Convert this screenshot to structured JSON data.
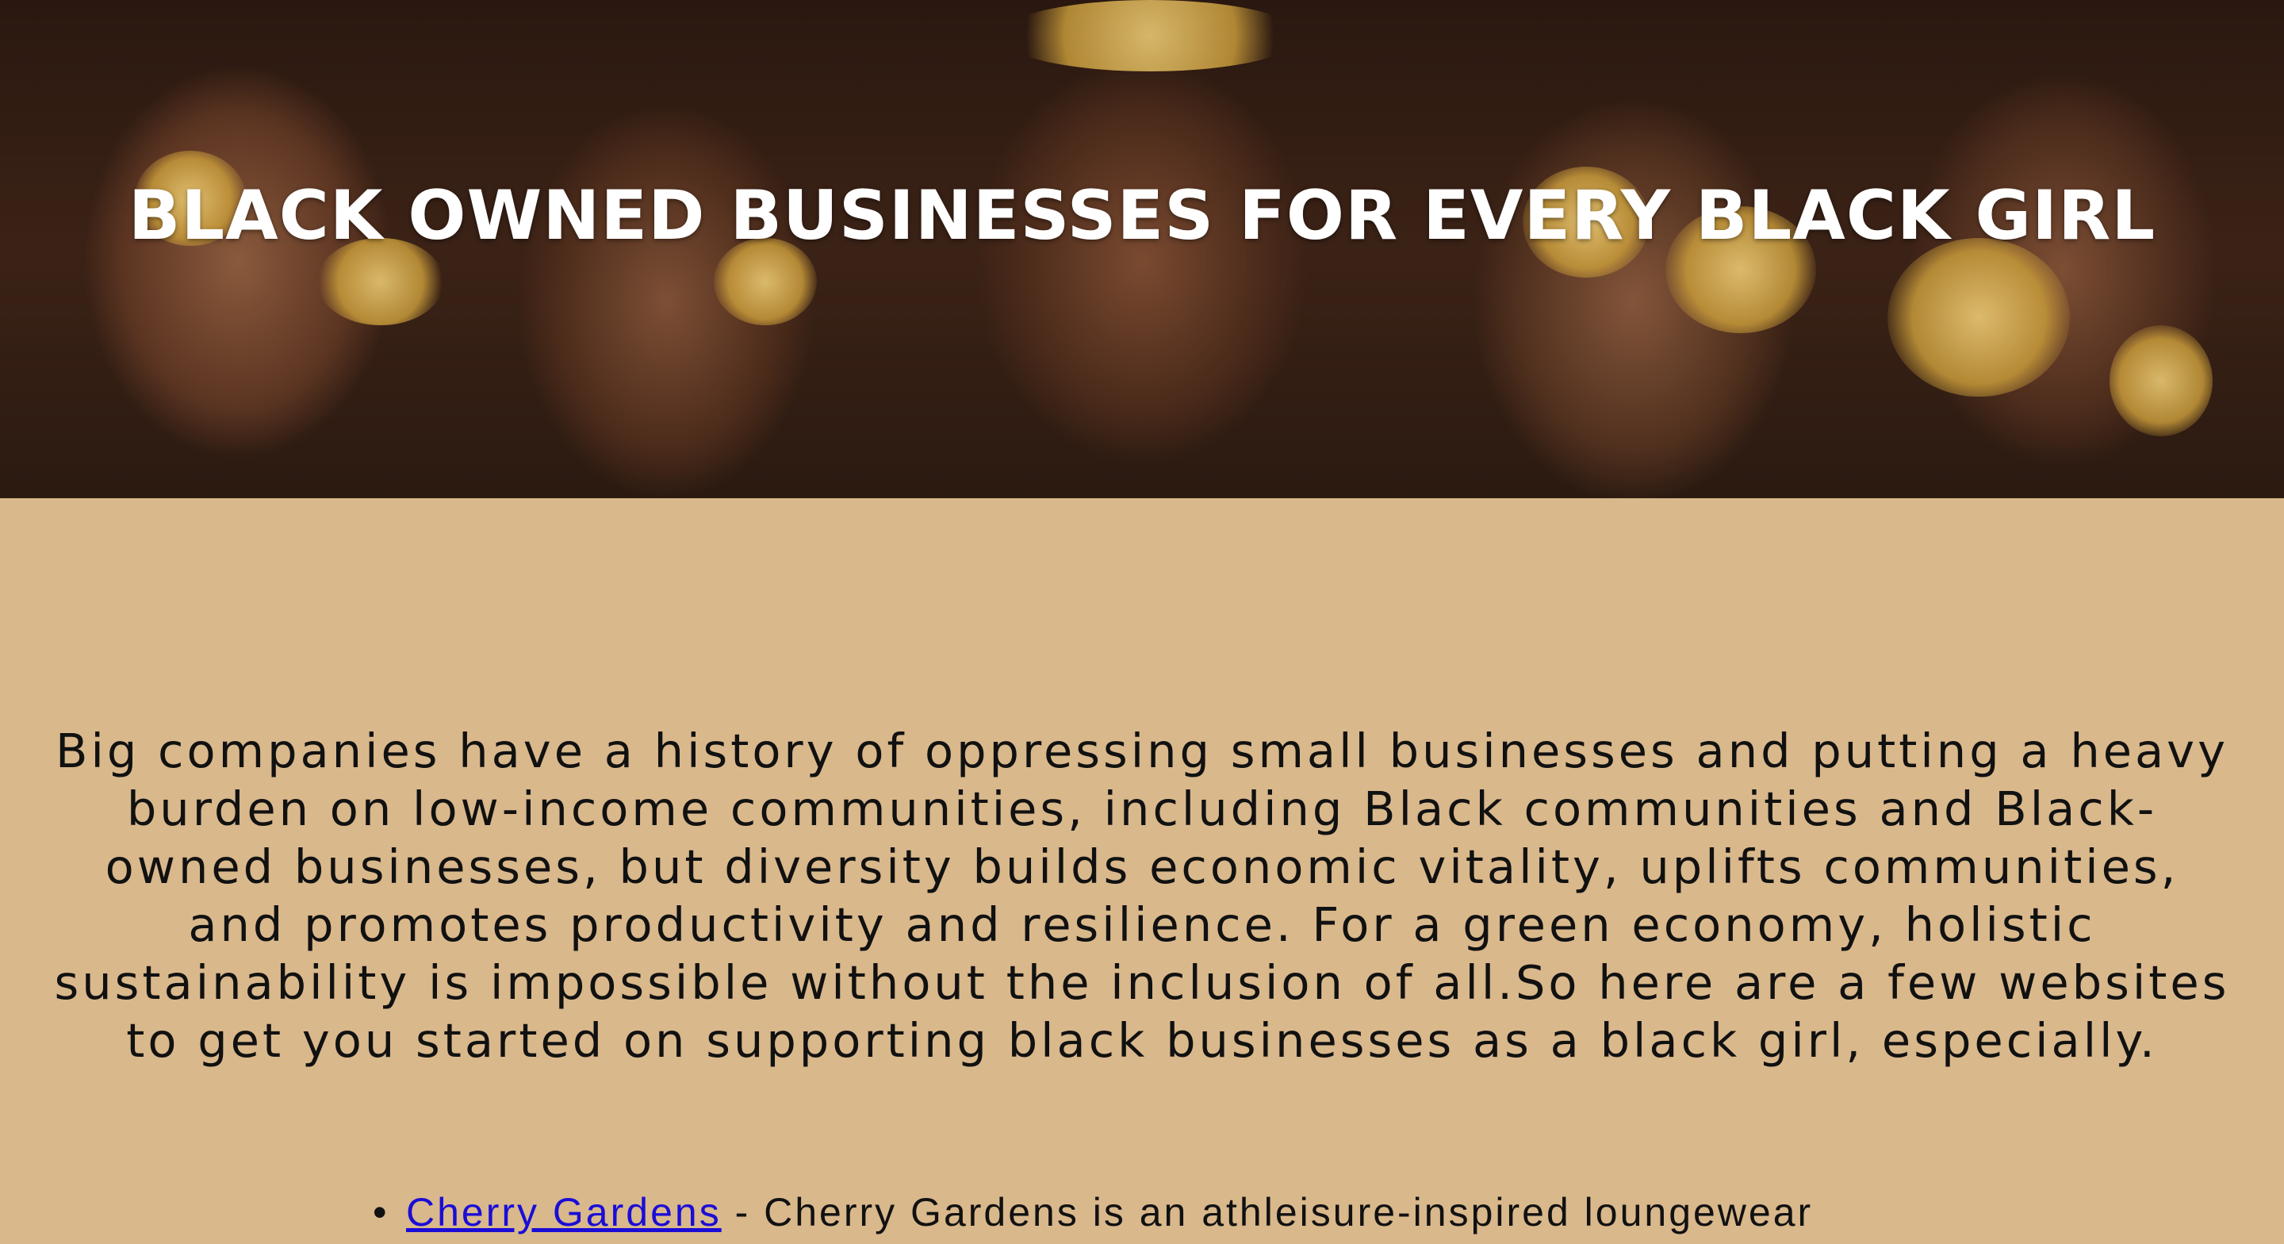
{
  "hero": {
    "title": "BLACK OWNED BUSINESSES FOR EVERY BLACK GIRL"
  },
  "intro": {
    "text": "Big companies have a history of oppressing small businesses and putting a heavy burden on low-income communities, including Black communities and Black-owned businesses, but diversity builds economic vitality, uplifts communities, and promotes productivity and resilience. For a green economy, holistic sustainability is impossible without the inclusion of all.So here are a few websites to get you started on supporting black businesses as a black girl, especially."
  },
  "businesses": [
    {
      "link_text": "Cherry Gardens",
      "description": " - Cherry Gardens is an athleisure-inspired loungewear"
    }
  ],
  "colors": {
    "page_background": "#d9b88c",
    "link": "#1a0dd6",
    "hero_title": "#ffffff"
  }
}
